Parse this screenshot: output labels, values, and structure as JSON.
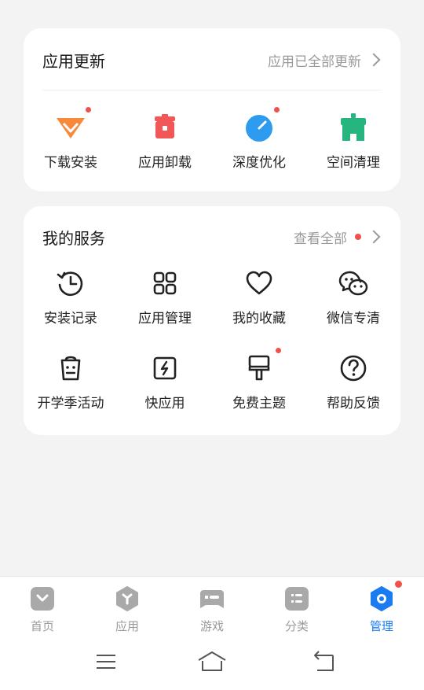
{
  "updates_card": {
    "title": "应用更新",
    "link_label": "应用已全部更新",
    "items": [
      {
        "label": "下载安装",
        "icon": "download-install-icon",
        "badge": true
      },
      {
        "label": "应用卸载",
        "icon": "uninstall-icon",
        "badge": false
      },
      {
        "label": "深度优化",
        "icon": "deep-optimize-icon",
        "badge": true
      },
      {
        "label": "空间清理",
        "icon": "space-clean-icon",
        "badge": false
      }
    ]
  },
  "services_card": {
    "title": "我的服务",
    "link_label": "查看全部",
    "items": [
      {
        "label": "安装记录",
        "icon": "install-history-icon",
        "badge": false
      },
      {
        "label": "应用管理",
        "icon": "app-manage-icon",
        "badge": false
      },
      {
        "label": "我的收藏",
        "icon": "heart-icon",
        "badge": false
      },
      {
        "label": "微信专清",
        "icon": "wechat-clean-icon",
        "badge": false
      },
      {
        "label": "开学季活动",
        "icon": "school-bag-icon",
        "badge": false
      },
      {
        "label": "快应用",
        "icon": "quick-app-icon",
        "badge": false
      },
      {
        "label": "免费主题",
        "icon": "paint-brush-icon",
        "badge": true
      },
      {
        "label": "帮助反馈",
        "icon": "help-icon",
        "badge": false
      }
    ]
  },
  "bottom_nav": [
    {
      "label": "首页",
      "icon": "home-tab-icon",
      "active": false
    },
    {
      "label": "应用",
      "icon": "apps-tab-icon",
      "active": false
    },
    {
      "label": "游戏",
      "icon": "gamepad-tab-icon",
      "active": false
    },
    {
      "label": "分类",
      "icon": "category-tab-icon",
      "active": false
    },
    {
      "label": "管理",
      "icon": "manage-tab-icon",
      "active": true,
      "badge": true
    }
  ],
  "colors": {
    "accent": "#1a7cf0",
    "badge": "#f0524b",
    "orange": "#f7893a",
    "red": "#f25757",
    "blue": "#2d9bf0",
    "green": "#26b57f",
    "tab_inactive": "#a9a9a9"
  }
}
